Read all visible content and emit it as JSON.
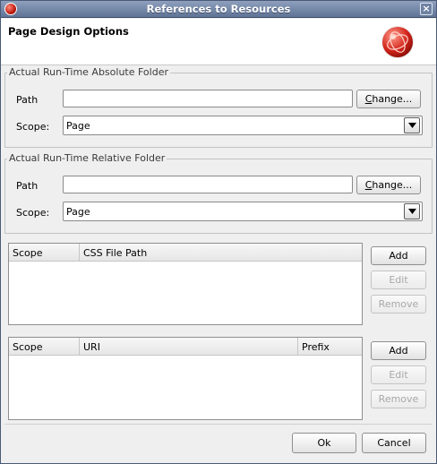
{
  "window": {
    "title": "References to Resources",
    "close_glyph": "×"
  },
  "banner": {
    "title": "Page Design Options"
  },
  "absolute_group": {
    "legend": "Actual Run-Time Absolute Folder",
    "path_label": "Path",
    "path_value": "",
    "change_label_underlined": "C",
    "change_label_rest": "hange...",
    "scope_label": "Scope:",
    "scope_value": "Page"
  },
  "relative_group": {
    "legend": "Actual Run-Time Relative Folder",
    "path_label": "Path",
    "path_value": "",
    "change_label_underlined": "C",
    "change_label_rest": "hange...",
    "scope_label": "Scope:",
    "scope_value": "Page"
  },
  "css_table": {
    "columns": [
      "Scope",
      "CSS File Path"
    ],
    "add_label": "Add",
    "edit_label": "Edit",
    "remove_label": "Remove"
  },
  "uri_table": {
    "columns": [
      "Scope",
      "URI",
      "Prefix"
    ],
    "add_label": "Add",
    "edit_label": "Edit",
    "remove_label": "Remove"
  },
  "footer": {
    "ok_label": "Ok",
    "cancel_label": "Cancel"
  },
  "colors": {
    "titlebar": "#6f82a3",
    "accent_red": "#d2241a",
    "disabled_text": "#a8a8a8"
  },
  "icons": {
    "app": "app-logo-icon",
    "close": "close-icon",
    "banner": "page-design-logo-icon",
    "dropdown": "chevron-down-icon"
  }
}
